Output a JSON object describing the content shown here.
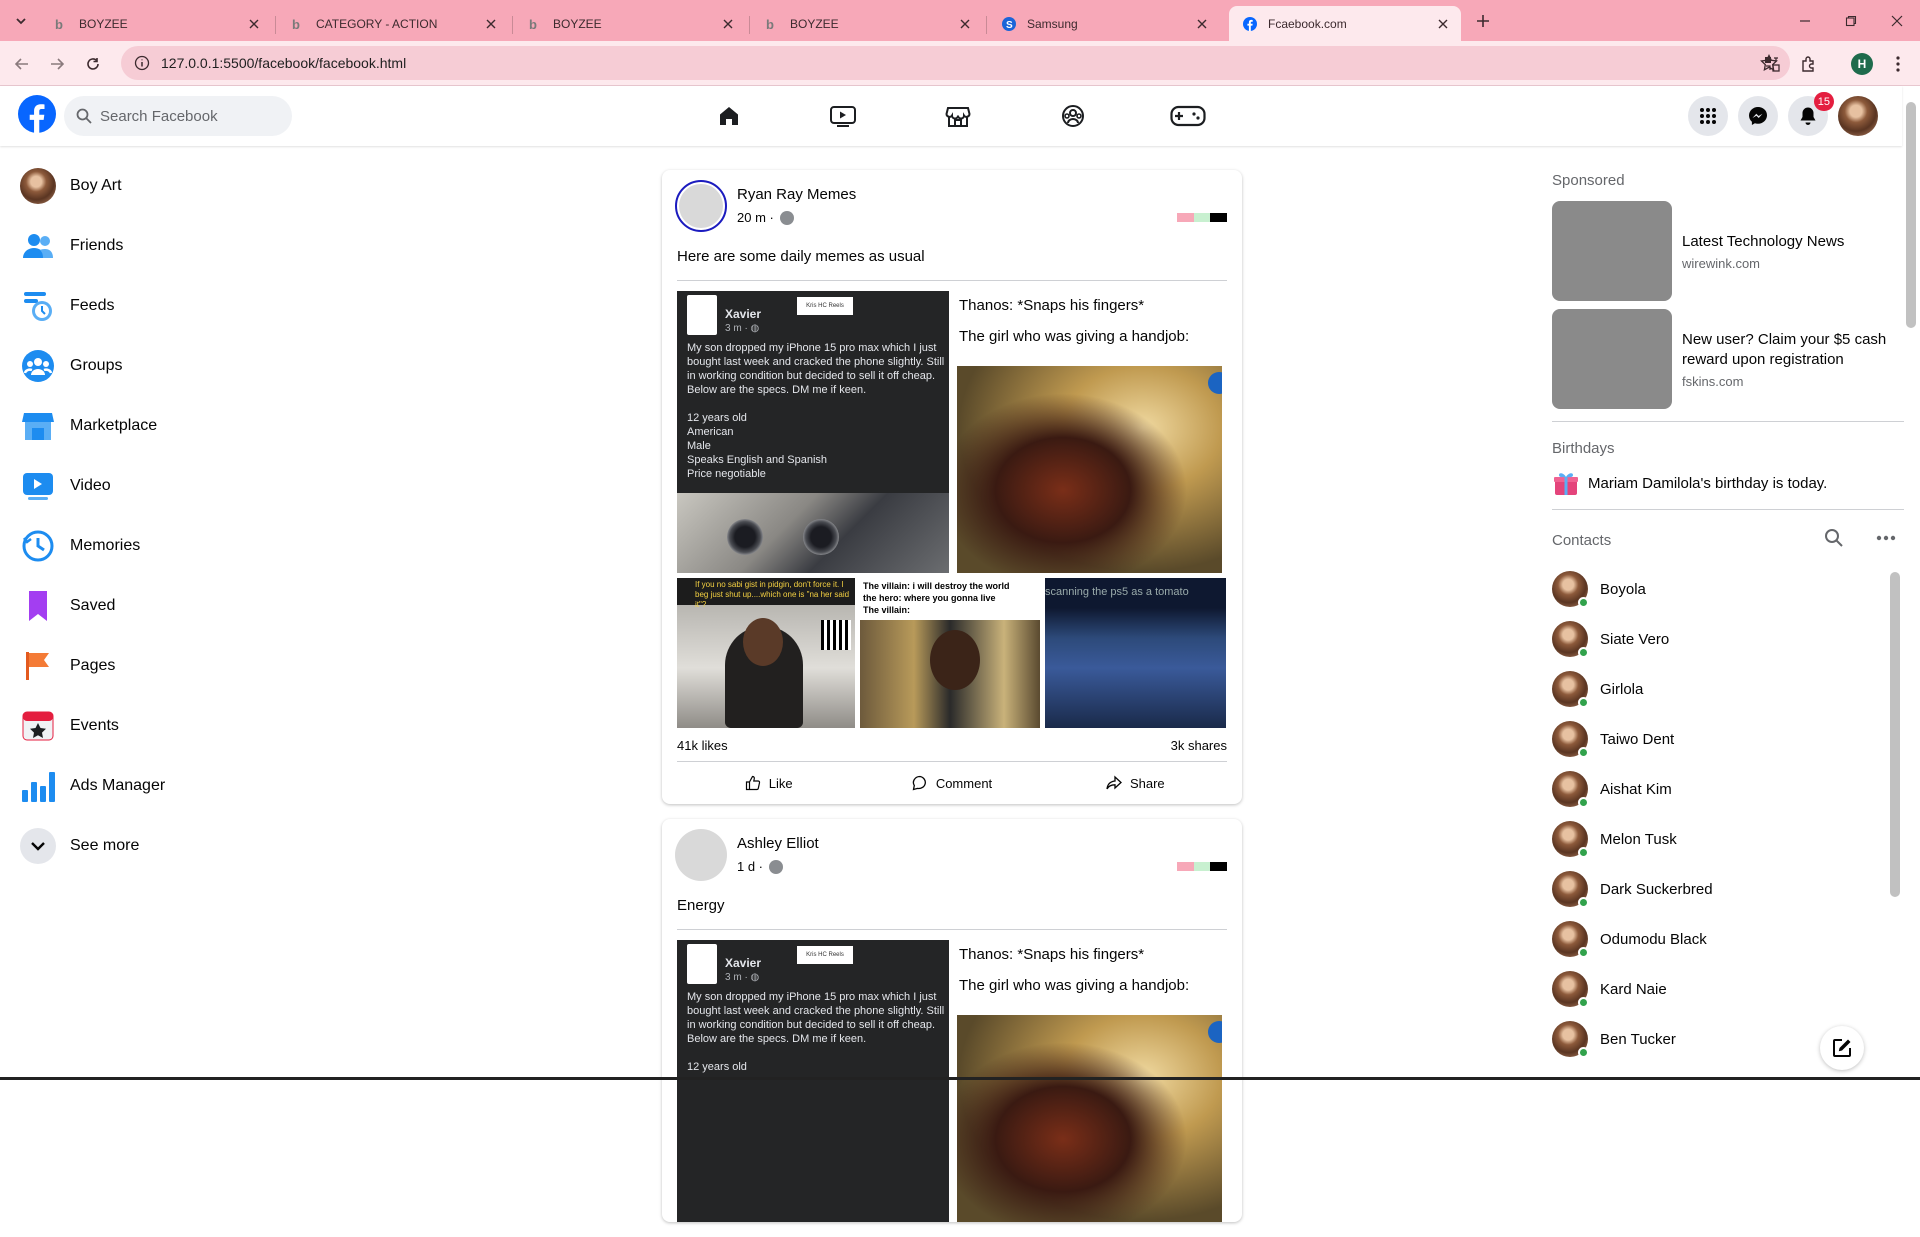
{
  "browser": {
    "tabs": [
      {
        "title": "BOYZEE",
        "active": false
      },
      {
        "title": "CATEGORY - ACTION",
        "active": false
      },
      {
        "title": "BOYZEE",
        "active": false
      },
      {
        "title": "BOYZEE",
        "active": false
      },
      {
        "title": "Samsung",
        "active": false
      },
      {
        "title": "Fcaebook.com",
        "active": true
      }
    ],
    "url": "127.0.0.1:5500/facebook/facebook.html",
    "profile_initial": "H",
    "colors": {
      "tab_strip": "#f7a8b8",
      "toolbar": "#fde9ed",
      "omnibox": "#f6ccd5"
    }
  },
  "header": {
    "search_placeholder": "Search Facebook",
    "notification_count": "15",
    "nav_icons": [
      "home-icon",
      "video-icon",
      "marketplace-icon",
      "groups-icon",
      "gaming-icon"
    ],
    "brand_color": "#0866ff"
  },
  "left": {
    "profile_name": "Boy Art",
    "items": [
      "Friends",
      "Feeds",
      "Groups",
      "Marketplace",
      "Video",
      "Memories",
      "Saved",
      "Pages",
      "Events",
      "Ads Manager"
    ],
    "see_more": "See more"
  },
  "posts": [
    {
      "author": "Ryan Ray Memes",
      "time": "20 m ·",
      "text": "Here are some daily memes as usual",
      "likes": "41k likes",
      "shares": "3k shares",
      "meme1": {
        "name": "Xavier",
        "time": "3 m · ◍",
        "tag": "Kris HC Reels",
        "body": "My son dropped my iPhone 15 pro max which I just bought last week and cracked the phone slightly. Still in working condition but decided to sell it off cheap. Below are the specs. DM me if keen.\n\n12 years old\nAmerican\nMale\nSpeaks English and Spanish\nPrice negotiable"
      },
      "meme2": {
        "line1": "Thanos: *Snaps his fingers*",
        "line2": "The girl who was giving a handjob:"
      },
      "meme3_caption": "If you no sabi gist in pidgin, don't force it. I beg just shut up....which one is \"na her said it\"?",
      "meme4_caption": "The villain: i will destroy the world\nthe hero: where you gonna live\nThe villain:",
      "meme5_caption": "scanning the ps5 as a tomato"
    },
    {
      "author": "Ashley Elliot",
      "time": "1 d ·",
      "text": "Energy",
      "meme1": {
        "name": "Xavier",
        "time": "3 m · ◍",
        "tag": "Kris HC Reels",
        "body": "My son dropped my iPhone 15 pro max which I just bought last week and cracked the phone slightly. Still in working condition but decided to sell it off cheap. Below are the specs. DM me if keen.\n\n12 years old"
      },
      "meme2": {
        "line1": "Thanos: *Snaps his fingers*",
        "line2": "The girl who was giving a handjob:"
      }
    }
  ],
  "actions": {
    "like": "Like",
    "comment": "Comment",
    "share": "Share"
  },
  "right": {
    "sponsored_title": "Sponsored",
    "ads": [
      {
        "title": "Latest Technology News",
        "site": "wirewink.com"
      },
      {
        "title": "New user? Claim your $5 cash reward upon registration",
        "site": "fskins.com"
      }
    ],
    "birthdays_title": "Birthdays",
    "birthday_name": "Mariam Damilola's",
    "birthday_text": " birthday is today.",
    "contacts_title": "Contacts",
    "contacts": [
      "Boyola",
      "Siate Vero",
      "Girlola",
      "Taiwo Dent",
      "Aishat Kim",
      "Melon Tusk",
      "Dark Suckerbred",
      "Odumodu Black",
      "Kard Naie",
      "Ben Tucker"
    ]
  }
}
